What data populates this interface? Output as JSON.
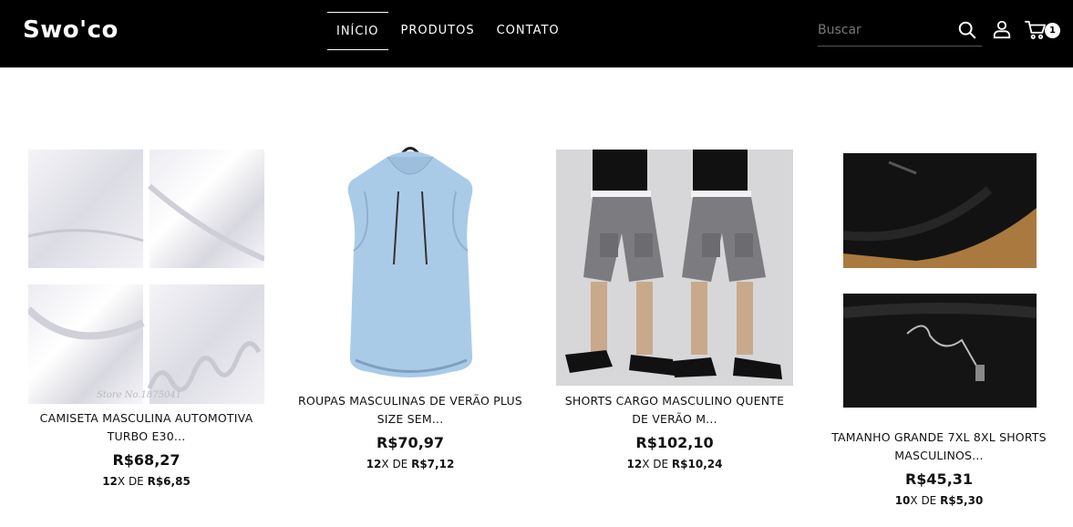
{
  "header": {
    "logo": "Swo'co",
    "nav": [
      {
        "label": "INÍCIO",
        "active": true
      },
      {
        "label": "PRODUTOS",
        "active": false
      },
      {
        "label": "CONTATO",
        "active": false
      }
    ],
    "search_placeholder": "Buscar",
    "cart_count": "1"
  },
  "products": [
    {
      "name_line1": "CAMISETA MASCULINA AUTOMOTIVA",
      "name_line2": "TURBO E30...",
      "price": "R$68,27",
      "installments_count": "12",
      "installments_sep": "X DE",
      "installments_value": "R$6,85",
      "watermark": "Store No.1875041"
    },
    {
      "name_line1": "ROUPAS MASCULINAS DE VERÃO PLUS",
      "name_line2": "SIZE SEM...",
      "price": "R$70,97",
      "installments_count": "12",
      "installments_sep": "X DE",
      "installments_value": "R$7,12"
    },
    {
      "name_line1": "SHORTS CARGO MASCULINO QUENTE",
      "name_line2": "DE VERÃO M...",
      "price": "R$102,10",
      "installments_count": "12",
      "installments_sep": "X DE",
      "installments_value": "R$10,24"
    },
    {
      "name_line1": "TAMANHO GRANDE 7XL 8XL SHORTS",
      "name_line2": "MASCULINOS...",
      "price": "R$45,31",
      "installments_count": "10",
      "installments_sep": "X DE",
      "installments_value": "R$5,30"
    }
  ],
  "colors": {
    "header_bg": "#000000",
    "page_bg": "#ffffff",
    "text": "#111111"
  },
  "icons": [
    "search-icon",
    "user-icon",
    "cart-icon"
  ]
}
